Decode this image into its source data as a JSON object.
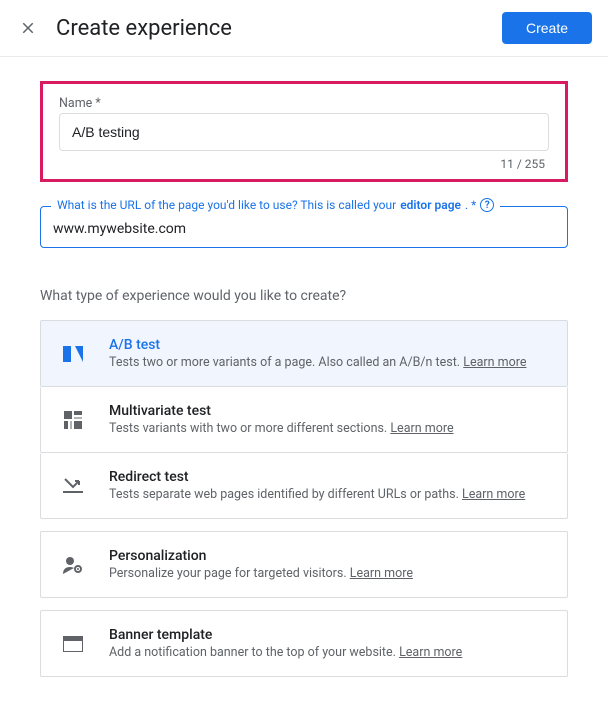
{
  "header": {
    "title": "Create experience",
    "create_label": "Create"
  },
  "name_field": {
    "label": "Name *",
    "value": "A/B testing",
    "counter": "11 / 255"
  },
  "url_field": {
    "legend_prefix": "What is the URL of the page you'd like to use? This is called your ",
    "legend_bold": "editor page",
    "legend_suffix": ". *",
    "value": "www.mywebsite.com"
  },
  "type_section": {
    "label": "What type of experience would you like to create?",
    "options": {
      "ab": {
        "title": "A/B test",
        "desc": "Tests two or more variants of a page. Also called an A/B/n test. ",
        "learn": "Learn more"
      },
      "mv": {
        "title": "Multivariate test",
        "desc": "Tests variants with two or more different sections. ",
        "learn": "Learn more"
      },
      "redirect": {
        "title": "Redirect test",
        "desc": "Tests separate web pages identified by different URLs or paths. ",
        "learn": "Learn more"
      },
      "perso": {
        "title": "Personalization",
        "desc": "Personalize your page for targeted visitors. ",
        "learn": "Learn more"
      },
      "banner": {
        "title": "Banner template",
        "desc": "Add a notification banner to the top of your website. ",
        "learn": "Learn more"
      }
    }
  }
}
